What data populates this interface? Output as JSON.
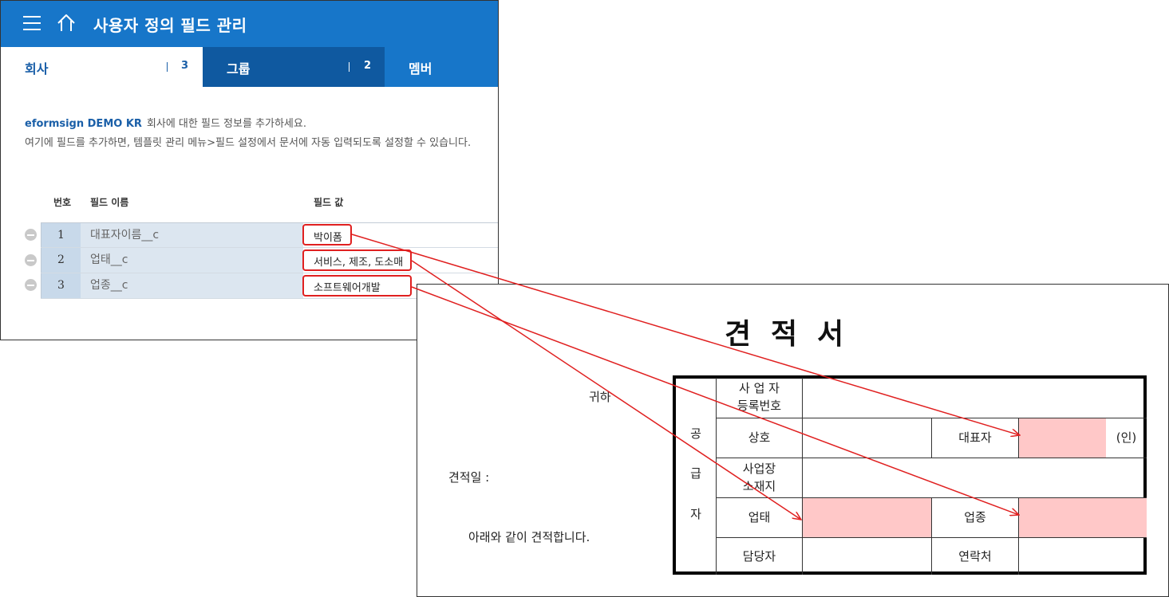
{
  "header": {
    "title": "사용자 정의 필드 관리"
  },
  "tabs": [
    {
      "label": "회사",
      "count": "3",
      "active": true
    },
    {
      "label": "그룹",
      "count": "2",
      "active": false
    },
    {
      "label": "멤버",
      "active": false
    }
  ],
  "description": {
    "company_name": "eformsign DEMO KR",
    "line1": "회사에 대한 필드 정보를 추가하세요.",
    "line2": "여기에 필드를 추가하면, 템플릿 관리 메뉴>필드 설정에서 문서에 자동 입력되도록 설정할 수 있습니다."
  },
  "table": {
    "headers": {
      "number": "번호",
      "field_name": "필드 이름",
      "field_value": "필드 값"
    },
    "rows": [
      {
        "number": "1",
        "field_name": "대표자이름__c",
        "field_value": "박이폼"
      },
      {
        "number": "2",
        "field_name": "업태__c",
        "field_value": "서비스, 제조, 도소매"
      },
      {
        "number": "3",
        "field_name": "업종__c",
        "field_value": "소프트웨어개발"
      }
    ]
  },
  "document": {
    "title_chars": [
      "견",
      "적",
      "서"
    ],
    "recipient_suffix": "귀하",
    "quote_date_label": "견적일 :",
    "statement": "아래와 같이 견적합니다.",
    "supplier_vertical": [
      "공",
      "급",
      "자"
    ],
    "cells": {
      "reg_no_line1": "사 업 자",
      "reg_no_line2": "등록번호",
      "company_name": "상호",
      "representative": "대표자",
      "seal": "(인)",
      "address_line1": "사업장",
      "address_line2": "소재지",
      "business_type": "업태",
      "business_item": "업종",
      "contact_person": "담당자",
      "contact": "연락처"
    }
  },
  "colors": {
    "header_bg": "#1776c9",
    "tab_group_bg": "#0f59a0",
    "accent_text": "#1a5fa8",
    "highlight_red": "#e02020",
    "mapped_cell_pink": "#ffc8c8"
  },
  "icons": {
    "menu": "hamburger-icon",
    "home": "home-icon",
    "remove": "minus-circle-icon"
  }
}
